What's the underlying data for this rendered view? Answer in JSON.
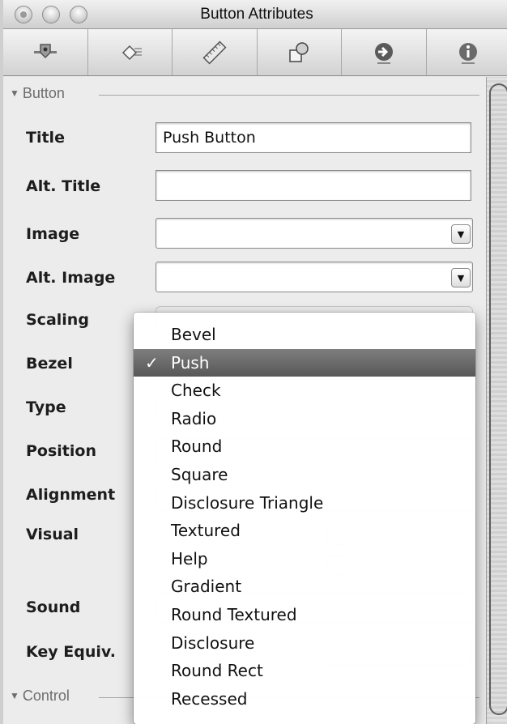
{
  "window": {
    "title": "Button Attributes"
  },
  "toolbar": {
    "tabs": [
      {
        "icon": "attributes-tab-icon"
      },
      {
        "icon": "effects-tab-icon"
      },
      {
        "icon": "size-ruler-tab-icon"
      },
      {
        "icon": "bindings-tab-icon"
      },
      {
        "icon": "connections-arrow-tab-icon"
      },
      {
        "icon": "info-tab-icon"
      }
    ]
  },
  "sections": {
    "button": "Button",
    "control": "Control"
  },
  "fields": {
    "title": {
      "label": "Title",
      "value": "Push Button"
    },
    "alt_title": {
      "label": "Alt. Title",
      "value": ""
    },
    "image": {
      "label": "Image",
      "value": ""
    },
    "alt_image": {
      "label": "Alt. Image",
      "value": ""
    },
    "scaling": {
      "label": "Scaling"
    },
    "bezel": {
      "label": "Bezel"
    },
    "type": {
      "label": "Type"
    },
    "position": {
      "label": "Position"
    },
    "alignment": {
      "label": "Alignment"
    },
    "visual": {
      "label": "Visual"
    },
    "sound": {
      "label": "Sound"
    },
    "key_equiv": {
      "label": "Key Equiv."
    }
  },
  "bezel_menu": {
    "check_mark": "✓",
    "selected_index": 1,
    "items": [
      "Bevel",
      "Push",
      "Check",
      "Radio",
      "Round",
      "Square",
      "Disclosure Triangle",
      "Textured",
      "Help",
      "Gradient",
      "Round Textured",
      "Disclosure",
      "Round Rect",
      "Recessed"
    ]
  },
  "colors": {
    "menu_selected": "#6b6b6b",
    "panel_bg": "#ececec"
  }
}
